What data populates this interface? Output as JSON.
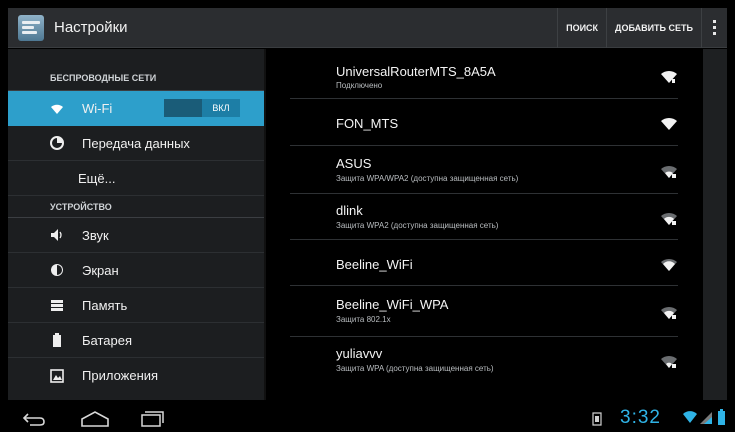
{
  "actionbar": {
    "title": "Настройки",
    "search_label": "ПОИСК",
    "add_network_label": "ДОБАВИТЬ СЕТЬ"
  },
  "sidebar": {
    "section_wireless": "БЕСПРОВОДНЫЕ СЕТИ",
    "wifi_label": "Wi-Fi",
    "wifi_toggle": "ВКЛ",
    "data_label": "Передача данных",
    "more_label": "Ещё...",
    "section_device": "УСТРОЙСТВО",
    "sound_label": "Звук",
    "screen_label": "Экран",
    "memory_label": "Память",
    "battery_label": "Батарея",
    "apps_label": "Приложения"
  },
  "networks": [
    {
      "name": "UniversalRouterMTS_8A5A",
      "status": "Подключено",
      "secured": false
    },
    {
      "name": "FON_MTS",
      "status": "",
      "secured": false
    },
    {
      "name": "ASUS",
      "status": "Защита WPA/WPA2 (доступна защищенная сеть)",
      "secured": true
    },
    {
      "name": "dlink",
      "status": "Защита WPA2 (доступна защищенная сеть)",
      "secured": true
    },
    {
      "name": "Beeline_WiFi",
      "status": "",
      "secured": false
    },
    {
      "name": "Beeline_WiFi_WPA",
      "status": "Защита 802.1x",
      "secured": true
    },
    {
      "name": "yuliavvv",
      "status": "Защита WPA (доступна защищенная сеть)",
      "secured": true
    }
  ],
  "statusbar": {
    "time": "3:32"
  },
  "colors": {
    "accent": "#2d9fcb",
    "clock": "#2fb3e6"
  }
}
